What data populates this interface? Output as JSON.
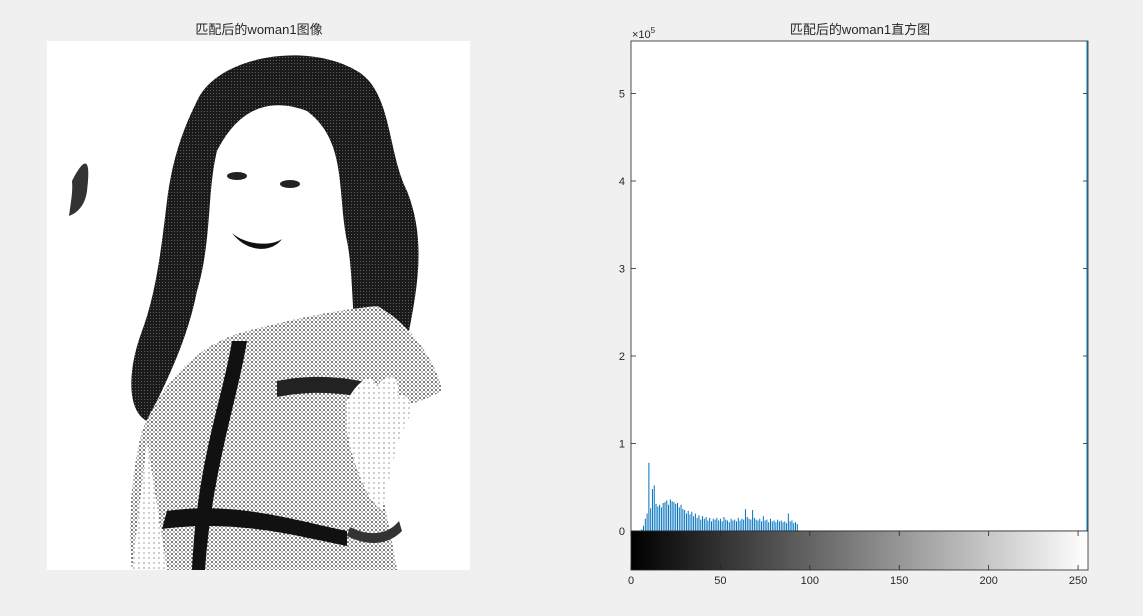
{
  "figure": {
    "left_title": "匹配后的woman1图像",
    "right_title": "匹配后的woman1直方图",
    "exponent_base": "×10",
    "exponent_power": "5"
  },
  "image_panel": {
    "subject": "woman1 histogram-matched grayscale photo"
  },
  "chart_data": {
    "type": "bar",
    "title": "匹配后的woman1直方图",
    "xlabel": "",
    "ylabel": "",
    "xlim": [
      0,
      255
    ],
    "ylim": [
      0,
      560000
    ],
    "y_exponent": 5,
    "xticks": [
      "0",
      "50",
      "100",
      "150",
      "200",
      "250"
    ],
    "yticks": [
      "0",
      "1",
      "2",
      "3",
      "4",
      "5"
    ],
    "bar_color": "#0072bd",
    "colorbar": "grayscale 0-255",
    "x": [
      6,
      7,
      8,
      9,
      10,
      11,
      12,
      13,
      14,
      15,
      16,
      17,
      18,
      19,
      20,
      21,
      22,
      23,
      24,
      25,
      26,
      27,
      28,
      29,
      30,
      31,
      32,
      33,
      34,
      35,
      36,
      37,
      38,
      39,
      40,
      41,
      42,
      43,
      44,
      45,
      46,
      47,
      48,
      49,
      50,
      51,
      52,
      53,
      54,
      55,
      56,
      57,
      58,
      59,
      60,
      61,
      62,
      63,
      64,
      65,
      66,
      67,
      68,
      69,
      70,
      71,
      72,
      73,
      74,
      75,
      76,
      77,
      78,
      79,
      80,
      81,
      82,
      83,
      84,
      85,
      86,
      87,
      88,
      89,
      90,
      91,
      92,
      93,
      255
    ],
    "values": [
      2000,
      6000,
      14000,
      20000,
      78000,
      26000,
      48000,
      52000,
      31000,
      28000,
      30000,
      27000,
      32000,
      33000,
      35000,
      30000,
      36000,
      34000,
      33000,
      31000,
      32000,
      27000,
      30000,
      25000,
      24000,
      20000,
      23000,
      19000,
      22000,
      17000,
      20000,
      15000,
      18000,
      13000,
      17000,
      14000,
      16000,
      12000,
      15000,
      11000,
      14000,
      13000,
      15000,
      12000,
      14000,
      11000,
      16000,
      13000,
      12000,
      10000,
      14000,
      12000,
      13000,
      11000,
      15000,
      12000,
      14000,
      13000,
      25000,
      16000,
      14000,
      13000,
      24000,
      15000,
      13000,
      12000,
      14000,
      11000,
      17000,
      12000,
      13000,
      10000,
      14000,
      11000,
      12000,
      10000,
      13000,
      11000,
      12000,
      10000,
      11000,
      9000,
      20000,
      11000,
      12000,
      9000,
      10000,
      8000,
      565000
    ]
  }
}
